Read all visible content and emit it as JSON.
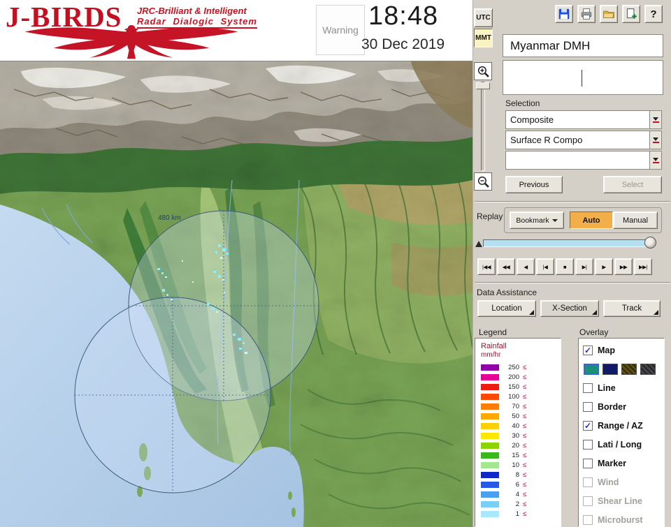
{
  "header": {
    "logo": {
      "title": "J-BIRDS",
      "subtitle1": "JRC-Brilliant & Intelligent",
      "subtitle2": "Radar  Dialogic  System"
    },
    "warning_label": "Warning",
    "clock": {
      "time": "18:48",
      "date": "30 Dec 2019"
    },
    "timezone": {
      "utc": "UTC",
      "mmt": "MMT",
      "selected": "MMT"
    },
    "toolbar": {
      "help_glyph": "?"
    },
    "station": "Myanmar DMH"
  },
  "selection_panel": {
    "label": "Selection",
    "dropdowns": [
      {
        "value": "Composite"
      },
      {
        "value": "Surface R Compo"
      },
      {
        "value": ""
      }
    ],
    "previous_button": "Previous",
    "select_button": "Select",
    "select_enabled": false
  },
  "replay": {
    "label": "Replay",
    "bookmark_button": "Bookmark",
    "auto_button": "Auto",
    "manual_button": "Manual",
    "mode_selected": "Auto",
    "playback_buttons": [
      {
        "glyph": "|◀◀",
        "name": "skip-to-start-button"
      },
      {
        "glyph": "◀◀",
        "name": "fast-rewind-button"
      },
      {
        "glyph": "◀",
        "name": "play-backward-button"
      },
      {
        "glyph": "|◀",
        "name": "step-back-button"
      },
      {
        "glyph": "■",
        "name": "stop-button"
      },
      {
        "glyph": "▶|",
        "name": "step-forward-button"
      },
      {
        "glyph": "▶",
        "name": "play-forward-button"
      },
      {
        "glyph": "▶▶",
        "name": "fast-forward-button"
      },
      {
        "glyph": "▶▶|",
        "name": "skip-to-end-button"
      }
    ]
  },
  "data_assistance": {
    "label": "Data Assistance",
    "buttons": [
      "Location",
      "X-Section",
      "Track"
    ]
  },
  "legend": {
    "label": "Legend",
    "title": "Rainfall",
    "unit": "mm/hr",
    "lte": "≤",
    "rows": [
      {
        "value": "250",
        "color": "#9000a8"
      },
      {
        "value": "200",
        "color": "#e40096"
      },
      {
        "value": "150",
        "color": "#ef1c10"
      },
      {
        "value": "100",
        "color": "#ff4800"
      },
      {
        "value": "70",
        "color": "#ff7d00"
      },
      {
        "value": "50",
        "color": "#ffa800"
      },
      {
        "value": "40",
        "color": "#ffd000"
      },
      {
        "value": "30",
        "color": "#ffe800"
      },
      {
        "value": "20",
        "color": "#8cd400"
      },
      {
        "value": "15",
        "color": "#38b81c"
      },
      {
        "value": "10",
        "color": "#a2e88e"
      },
      {
        "value": "8",
        "color": "#1028c8"
      },
      {
        "value": "6",
        "color": "#2858e8"
      },
      {
        "value": "4",
        "color": "#48a0f0"
      },
      {
        "value": "2",
        "color": "#78d0f8"
      },
      {
        "value": "1",
        "color": "#a8e8fc"
      }
    ]
  },
  "overlay": {
    "label": "Overlay",
    "items": [
      {
        "label": "Map",
        "checked": true,
        "enabled": true
      },
      {
        "label": "Line",
        "checked": false,
        "enabled": true
      },
      {
        "label": "Border",
        "checked": false,
        "enabled": true
      },
      {
        "label": "Range / AZ",
        "checked": true,
        "enabled": true
      },
      {
        "label": "Lati / Long",
        "checked": false,
        "enabled": true
      },
      {
        "label": "Marker",
        "checked": false,
        "enabled": true
      },
      {
        "label": "Wind",
        "checked": false,
        "enabled": false
      },
      {
        "label": "Shear Line",
        "checked": false,
        "enabled": false
      },
      {
        "label": "Microburst",
        "checked": false,
        "enabled": false
      }
    ],
    "map_styles": [
      "#1d8f78",
      "#101a66",
      "#5c5014",
      "#44444a"
    ],
    "selected_style": 0
  },
  "map": {
    "range_label": "480 km"
  },
  "colors": {
    "brand_red": "#c40f20",
    "accent_amber": "#f2ae48",
    "slider_track": "#b5e0f2",
    "panel_gray": "#d4d0c8",
    "sea_blue": "#b3cfe8"
  }
}
